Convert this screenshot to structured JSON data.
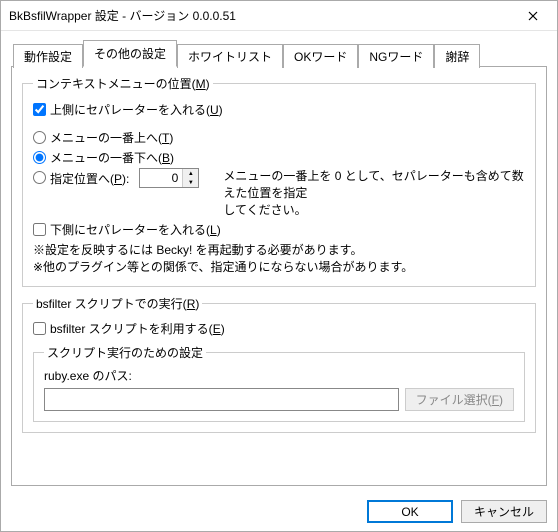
{
  "window": {
    "title": "BkBsfilWrapper 設定  -  バージョン 0.0.0.51"
  },
  "tabs": [
    {
      "label": "動作設定"
    },
    {
      "label": "その他の設定"
    },
    {
      "label": "ホワイトリスト"
    },
    {
      "label": "OKワード"
    },
    {
      "label": "NGワード"
    },
    {
      "label": "謝辞"
    }
  ],
  "group_context": {
    "legend_prefix": "コンテキストメニューの位置(",
    "legend_key": "M",
    "legend_suffix": ")",
    "chk_upper_sep_prefix": "上側にセパレーターを入れる(",
    "chk_upper_sep_key": "U",
    "chk_upper_sep_suffix": ")",
    "radio_top_prefix": "メニューの一番上へ(",
    "radio_top_key": "T",
    "radio_top_suffix": ")",
    "radio_bottom_prefix": "メニューの一番下へ(",
    "radio_bottom_key": "B",
    "radio_bottom_suffix": ")",
    "radio_pos_prefix": "指定位置へ(",
    "radio_pos_key": "P",
    "radio_pos_suffix": "):",
    "spin_value": "0",
    "hint_line1": "メニューの一番上を 0 として、セパレーターも含めて数えた位置を指定",
    "hint_line2": "してください。",
    "chk_lower_sep_prefix": "下側にセパレーターを入れる(",
    "chk_lower_sep_key": "L",
    "chk_lower_sep_suffix": ")",
    "note_line1": "※設定を反映するには Becky! を再起動する必要があります。",
    "note_line2": "※他のプラグイン等との関係で、指定通りにならない場合があります。"
  },
  "group_script": {
    "legend_prefix": "bsfilter スクリプトでの実行(",
    "legend_key": "R",
    "legend_suffix": ")",
    "chk_use_prefix": "bsfilter スクリプトを利用する(",
    "chk_use_key": "E",
    "chk_use_suffix": ")",
    "inner_legend": "スクリプト実行のための設定",
    "ruby_label": "ruby.exe のパス:",
    "ruby_value": "",
    "browse_prefix": "ファイル選択(",
    "browse_key": "F",
    "browse_suffix": ")"
  },
  "footer": {
    "ok": "OK",
    "cancel": "キャンセル"
  }
}
